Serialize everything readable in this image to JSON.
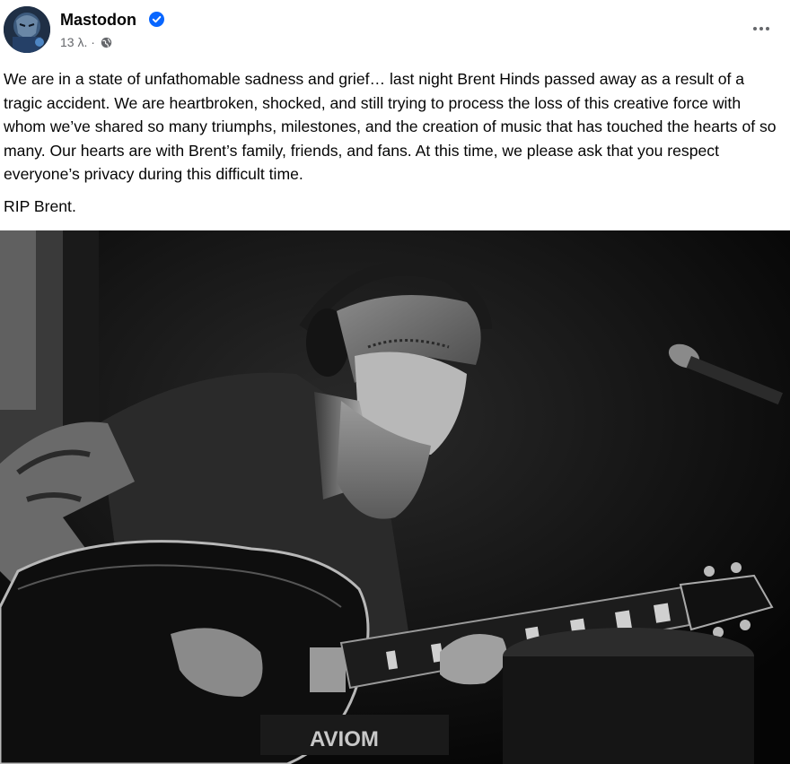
{
  "post": {
    "author": "Mastodon",
    "verified": true,
    "timestamp": "13 λ. ·",
    "audience_icon": "globe-icon",
    "more_icon": "more-options-icon",
    "text": "We are in a state of unfathomable sadness and grief… last night Brent Hinds passed away as a result of a tragic accident. We are heartbroken, shocked, and still trying to process the loss of this creative force with whom we’ve shared so many triumphs, milestones, and the creation of music that has touched the hearts of so many. Our hearts are with Brent’s family, friends, and fans. At this time, we please ask that you respect everyone’s privacy during this difficult time.",
    "closing": "RIP Brent."
  },
  "photo": {
    "amp_logo_text": "AVIOM"
  },
  "colors": {
    "verified_blue": "#0866ff",
    "meta_gray": "#65676b"
  }
}
